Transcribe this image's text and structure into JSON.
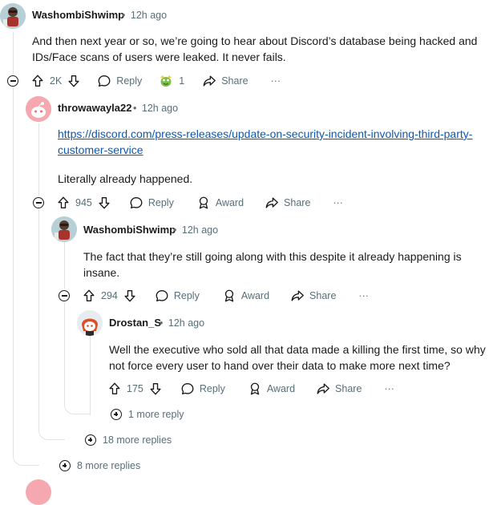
{
  "comments": [
    {
      "username": "WashombiShwimp",
      "time": "12h ago",
      "text": "And then next year or so, we’re going to hear about Discord’s database being hacked and IDs/Face scans of users were leaked. It never fails.",
      "votes": "2K",
      "reply_label": "Reply",
      "award_count": "1",
      "share_label": "Share",
      "more_label": "···"
    },
    {
      "username": "throwawayla22",
      "time": "12h ago",
      "link_line1": "https://discord.com/press-releases/update-on-security-incident-involving-third-party-",
      "link_line2": "customer-service",
      "text": "Literally already happened.",
      "votes": "945",
      "reply_label": "Reply",
      "award_label": "Award",
      "share_label": "Share",
      "more_label": "···"
    },
    {
      "username": "WashombiShwimp",
      "time": "12h ago",
      "text": "The fact that they’re still going along with this despite it already happening is insane.",
      "votes": "294",
      "reply_label": "Reply",
      "award_label": "Award",
      "share_label": "Share",
      "more_label": "···"
    },
    {
      "username": "Drostan_S",
      "time": "12h ago",
      "text": "Well the executive who sold all that data made a killing the first time, so why not force every user to hand over their data to make more next time?",
      "votes": "175",
      "reply_label": "Reply",
      "award_label": "Award",
      "share_label": "Share",
      "more_label": "···"
    }
  ],
  "more_replies": {
    "level4": "1 more reply",
    "level3": "18 more replies",
    "level2": "8 more replies"
  },
  "meta_separator": "•",
  "icons": {
    "upvote": "arrow-up-icon",
    "downvote": "arrow-down-icon",
    "reply": "speech-bubble-icon",
    "award": "award-icon",
    "share": "share-arrow-icon",
    "collapse": "minus-circle-icon",
    "expand": "plus-circle-icon"
  },
  "colors": {
    "text": "#1a1a1b",
    "meta": "#576f76",
    "link": "#0b58b4",
    "thread": "#e0e3e6"
  }
}
